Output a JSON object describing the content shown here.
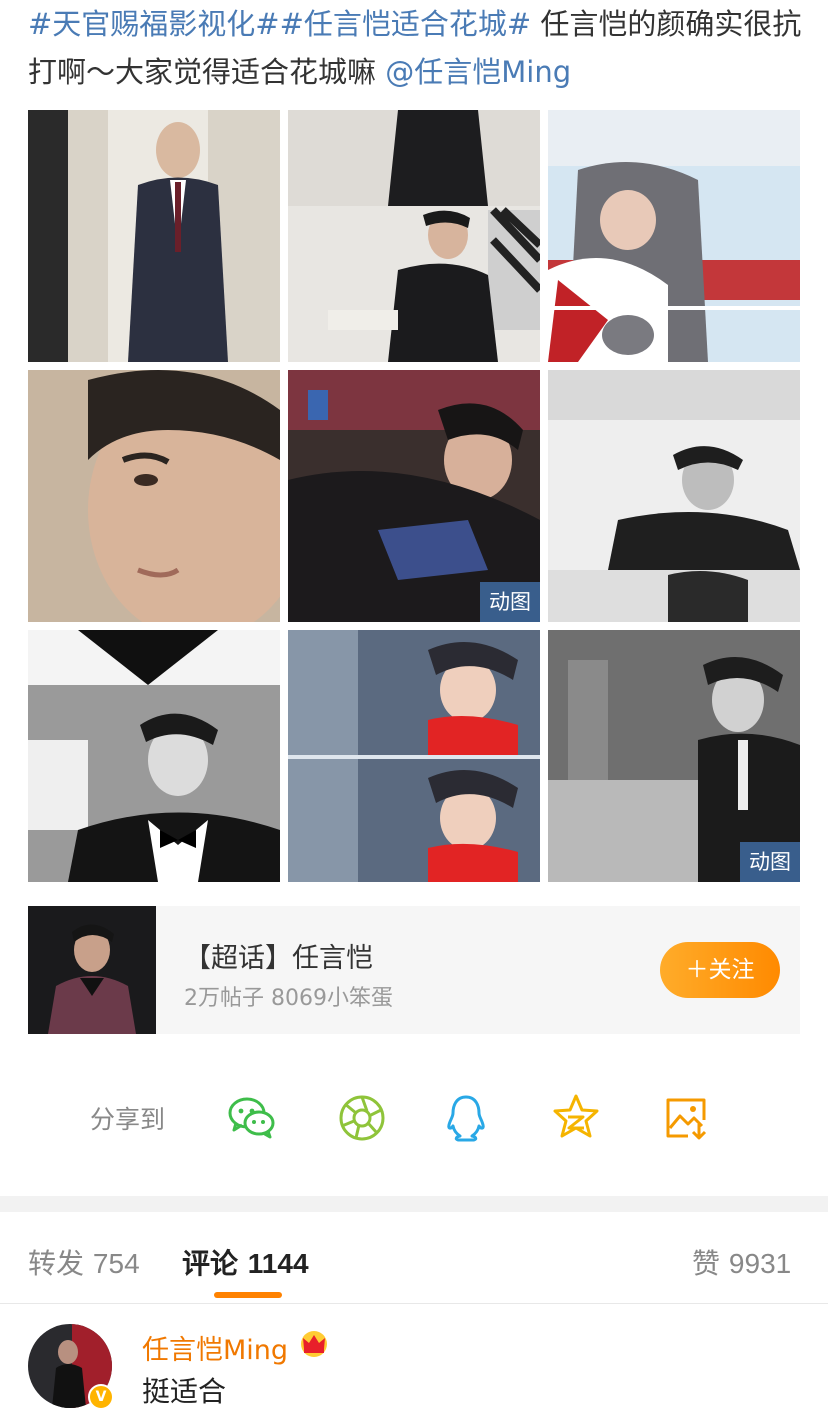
{
  "post": {
    "hashtag1": "#天官赐福影视化#",
    "hashtag2": "#任言恺适合花城#",
    "text": " 任言恺的颜确实很抗打啊～大家觉得适合花城嘛 ",
    "mention": "@任言恺Ming"
  },
  "grid": {
    "gif_badge_1": "动图",
    "gif_badge_2": "动图"
  },
  "topic": {
    "title": "【超话】任言恺",
    "meta": "2万帖子 8069小笨蛋",
    "follow_label": "＋关注"
  },
  "share": {
    "label": "分享到",
    "icons": [
      "wechat-icon",
      "moments-icon",
      "qq-icon",
      "qzone-icon",
      "save-image-icon"
    ]
  },
  "tabs": {
    "repost_label": "转发",
    "repost_count": "754",
    "comment_label": "评论",
    "comment_count": "1144",
    "like_label": "赞",
    "like_count": "9931"
  },
  "comment": {
    "author": "任言恺Ming",
    "text": "挺适合"
  },
  "colors": {
    "link": "#4a7bb5",
    "accent": "#ff8200",
    "author": "#f07800"
  }
}
